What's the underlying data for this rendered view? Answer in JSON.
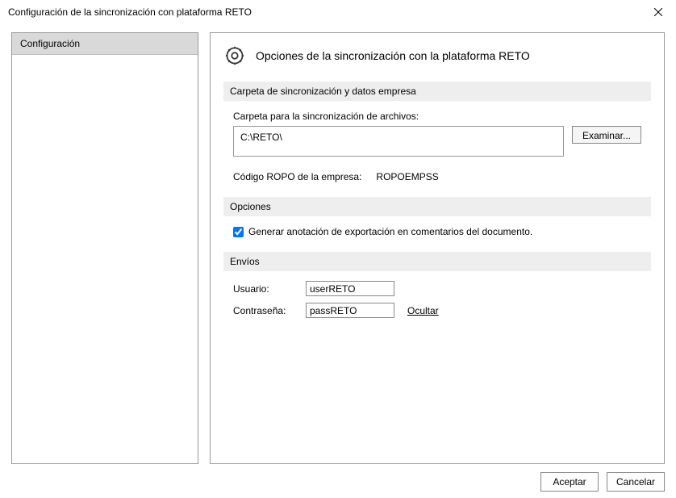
{
  "window": {
    "title": "Configuración de la sincronización con plataforma RETO"
  },
  "sidebar": {
    "items": [
      {
        "label": "Configuración"
      }
    ]
  },
  "main": {
    "header_title": "Opciones de la sincronización con la plataforma RETO",
    "section_folder": {
      "title": "Carpeta de sincronización y datos empresa",
      "folder_label": "Carpeta para la sincronización de archivos:",
      "folder_value": "C:\\RETO\\",
      "browse_label": "Examinar...",
      "ropo_label": "Código ROPO de la empresa:",
      "ropo_value": "ROPOEMPSS"
    },
    "section_options": {
      "title": "Opciones",
      "checkbox_label": "Generar anotación de exportación en comentarios del documento.",
      "checkbox_checked": true
    },
    "section_envios": {
      "title": "Envíos",
      "user_label": "Usuario:",
      "user_value": "userRETO",
      "pass_label": "Contraseña:",
      "pass_value": "passRETO",
      "hide_label": "Ocultar"
    }
  },
  "buttons": {
    "accept": "Aceptar",
    "cancel": "Cancelar"
  }
}
